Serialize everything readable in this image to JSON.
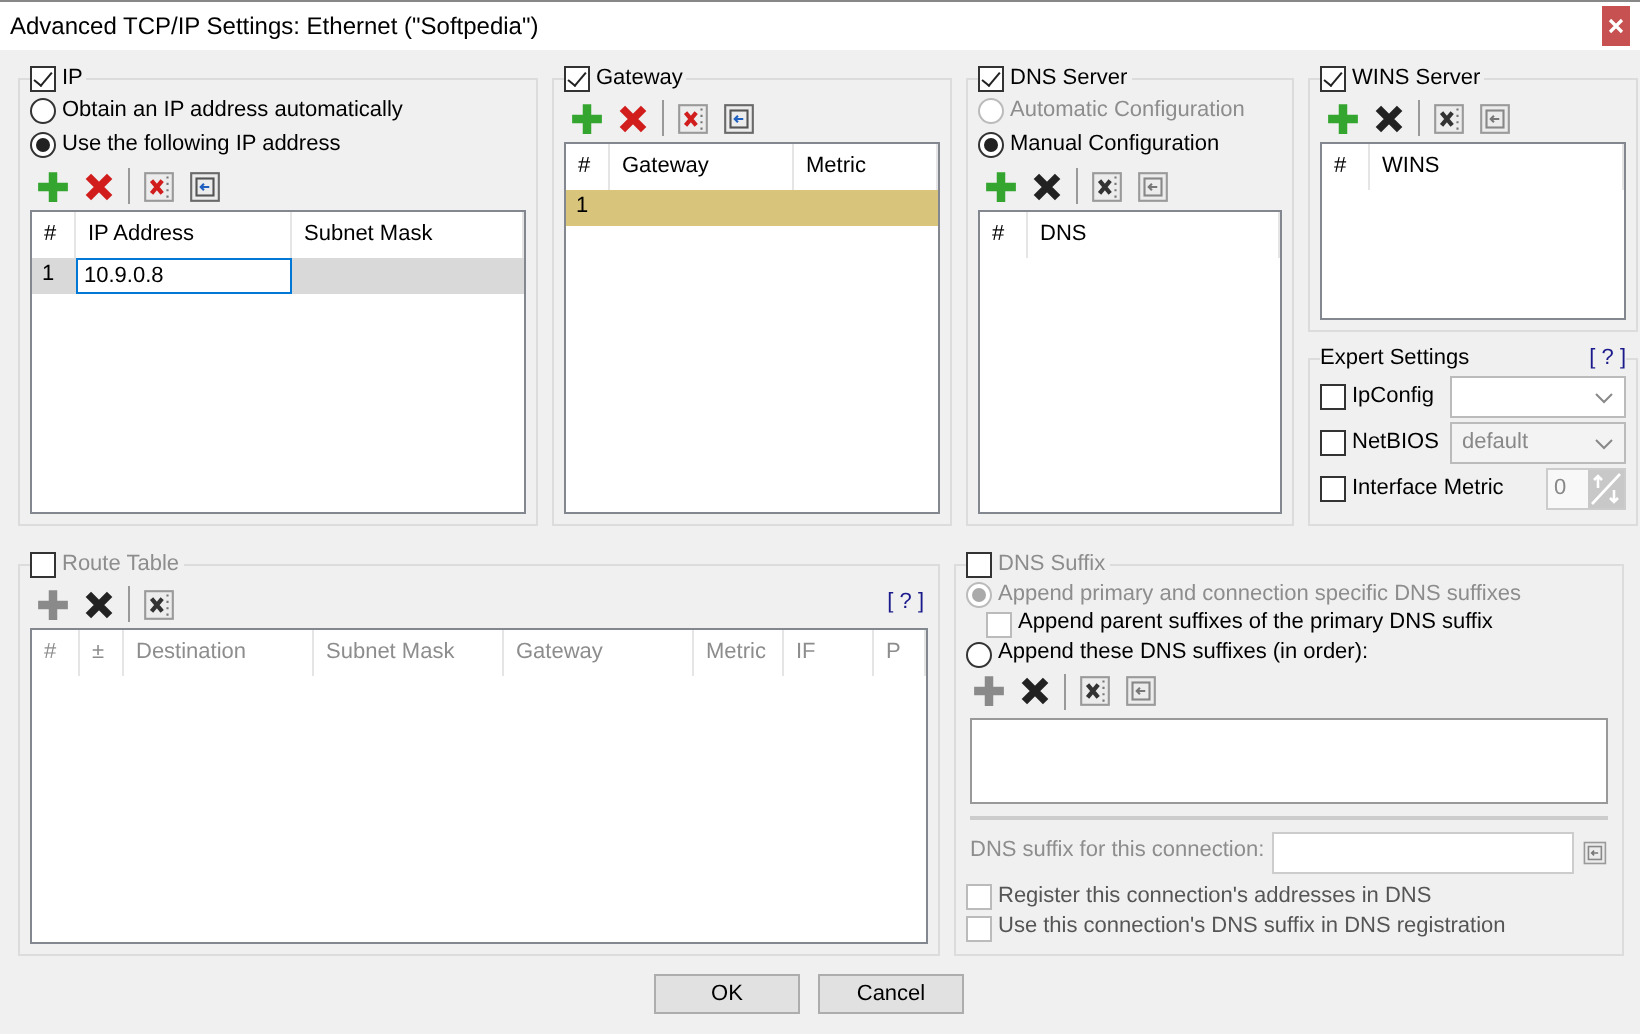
{
  "window": {
    "title": "Advanced TCP/IP Settings: Ethernet (\"Softpedia\")"
  },
  "ip": {
    "label": "IP",
    "checked": true,
    "disabled": false,
    "radios": [
      {
        "label": "Obtain an IP address automatically",
        "selected": false,
        "disabled": false
      },
      {
        "label": "Use the following IP address",
        "selected": true,
        "disabled": false
      }
    ],
    "tools": [
      {
        "kind": "add",
        "disabled": false
      },
      {
        "kind": "delete",
        "disabled": false
      },
      {
        "kind": "clear",
        "disabled": false
      },
      {
        "kind": "import",
        "disabled": false
      }
    ],
    "table": {
      "columns": [
        "#",
        "IP Address",
        "Subnet Mask"
      ],
      "rows": [
        {
          "selected": true,
          "cells": [
            {
              "text": "1",
              "editing": false
            },
            {
              "text": "10.9.0.8",
              "editing": true
            }
          ]
        }
      ]
    }
  },
  "gateway": {
    "label": "Gateway",
    "checked": true,
    "disabled": false,
    "tools": [
      {
        "kind": "add",
        "disabled": false
      },
      {
        "kind": "delete",
        "disabled": false
      },
      {
        "kind": "clear",
        "disabled": false
      },
      {
        "kind": "import",
        "disabled": false
      }
    ],
    "table": {
      "columns": [
        "#",
        "Gateway",
        "Metric"
      ],
      "rows": [
        {
          "selected": true,
          "cells": [
            {
              "text": "1",
              "editing": false
            }
          ]
        }
      ]
    }
  },
  "dns": {
    "label": "DNS Server",
    "checked": true,
    "disabled": false,
    "radios": [
      {
        "label": "Automatic Configuration",
        "selected": false,
        "disabled": true
      },
      {
        "label": "Manual Configuration",
        "selected": true,
        "disabled": false
      }
    ],
    "tools": [
      {
        "kind": "add",
        "disabled": false
      },
      {
        "kind": "delete",
        "disabled": true
      },
      {
        "kind": "clear",
        "disabled": true
      },
      {
        "kind": "import",
        "disabled": true
      }
    ],
    "table": {
      "columns": [
        "#",
        "DNS"
      ]
    }
  },
  "wins": {
    "label": "WINS Server",
    "checked": true,
    "disabled": false,
    "tools": [
      {
        "kind": "add",
        "disabled": false
      },
      {
        "kind": "delete",
        "disabled": true
      },
      {
        "kind": "clear",
        "disabled": true
      },
      {
        "kind": "import",
        "disabled": true
      }
    ],
    "table": {
      "columns": [
        "#",
        "WINS"
      ]
    }
  },
  "expert": {
    "title": "Expert Settings",
    "help": "[ ? ]",
    "rows": [
      {
        "kind": "select",
        "label": "IpConfig",
        "checked": false,
        "disabled": false
      },
      {
        "kind": "select",
        "label": "NetBIOS",
        "checked": false,
        "disabled": true,
        "value": "default"
      },
      {
        "kind": "number",
        "label": "Interface Metric",
        "checked": false,
        "disabled": true,
        "value": "0"
      }
    ]
  },
  "route": {
    "label": "Route Table",
    "checked": false,
    "disabled": true,
    "help": "[ ? ]",
    "tools": [
      {
        "kind": "add",
        "disabled": true
      },
      {
        "kind": "delete",
        "disabled": true
      },
      {
        "kind": "clear",
        "disabled": true
      }
    ],
    "table": {
      "columns": [
        "#",
        "±",
        "Destination",
        "Subnet Mask",
        "Gateway",
        "Metric",
        "IF",
        "P"
      ]
    }
  },
  "suffix": {
    "label": "DNS Suffix",
    "checked": false,
    "disabled": true,
    "options": [
      {
        "kind": "radio",
        "label": "Append primary and connection specific DNS suffixes",
        "selected": true,
        "disabled": true,
        "children": [
          {
            "kind": "checkbox",
            "label": "Append parent suffixes of the primary DNS suffix",
            "checked": false
          }
        ]
      },
      {
        "kind": "radio",
        "label": "Append these DNS suffixes (in order):",
        "selected": false,
        "disabled": false
      }
    ],
    "tools": [
      {
        "kind": "add",
        "disabled": true
      },
      {
        "kind": "delete",
        "disabled": true
      },
      {
        "kind": "clear",
        "disabled": true
      },
      {
        "kind": "import",
        "disabled": true
      }
    ],
    "connection_label": "DNS suffix for this connection:",
    "checkboxes": [
      {
        "label": "Register this connection's addresses in DNS",
        "checked": false
      },
      {
        "label": "Use this connection's DNS suffix in DNS registration",
        "checked": false
      }
    ]
  },
  "buttons": [
    "OK",
    "Cancel"
  ]
}
